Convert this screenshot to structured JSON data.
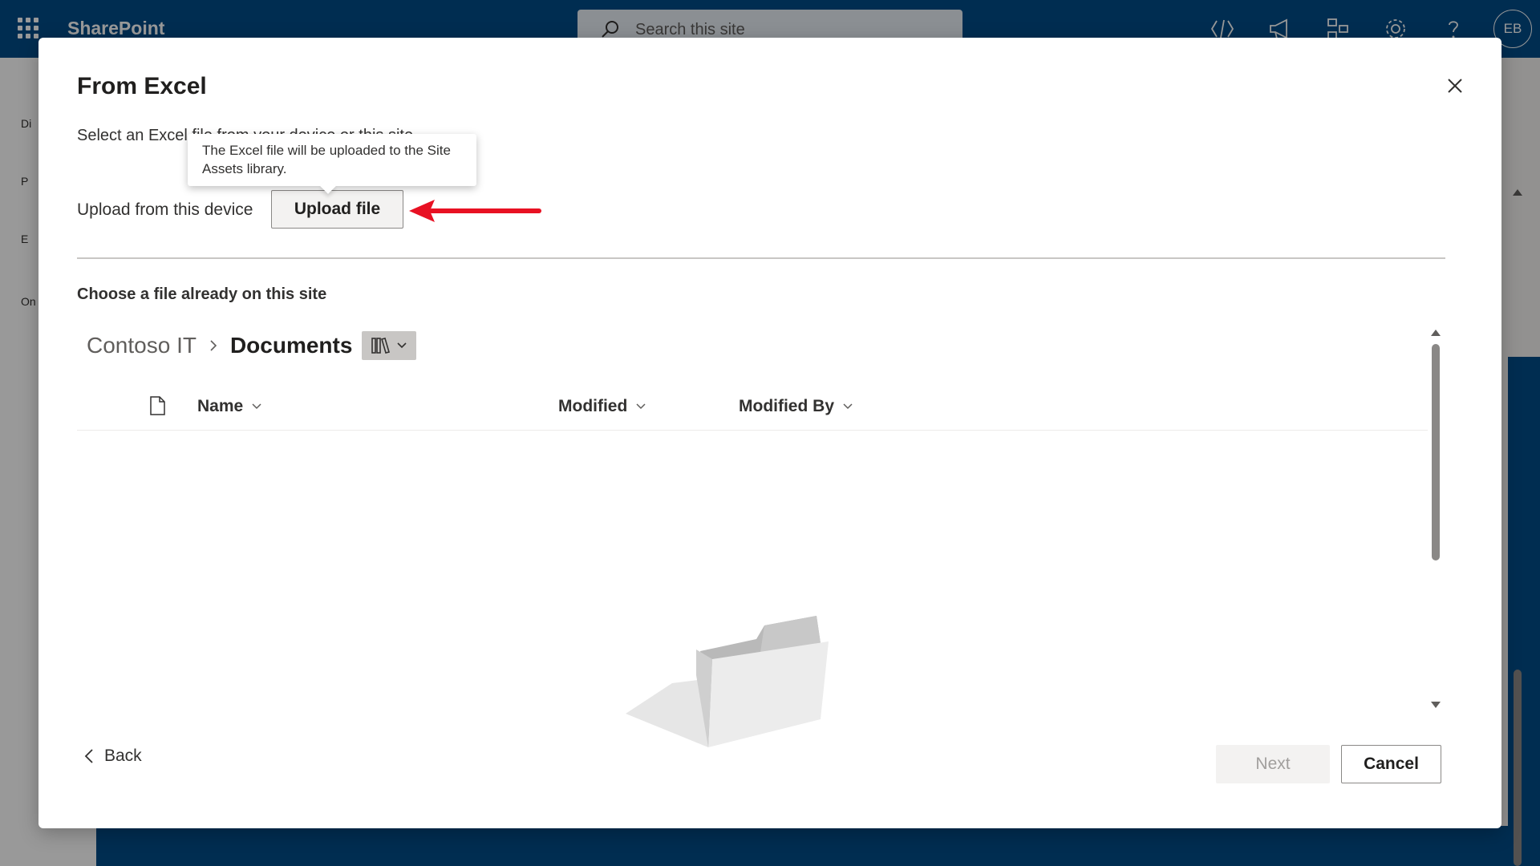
{
  "suite_bar": {
    "app_name": "SharePoint",
    "search_placeholder": "Search this site",
    "avatar_initials": "EB",
    "color": "#004b87"
  },
  "left_rail": {
    "items": [
      "Di",
      "P",
      "E",
      "On"
    ]
  },
  "dialog": {
    "title": "From Excel",
    "subtitle": "Select an Excel file from your device or this site",
    "upload_label": "Upload from this device",
    "upload_button": "Upload file",
    "tooltip": "The Excel file will be uploaded to the Site Assets library.",
    "section_title": "Choose a file already on this site",
    "breadcrumb": {
      "site": "Contoso IT",
      "library": "Documents"
    },
    "columns": {
      "name": "Name",
      "modified": "Modified",
      "modified_by": "Modified By"
    },
    "footer": {
      "back": "Back",
      "next": "Next",
      "cancel": "Cancel"
    },
    "annotation_color": "#e81123"
  }
}
